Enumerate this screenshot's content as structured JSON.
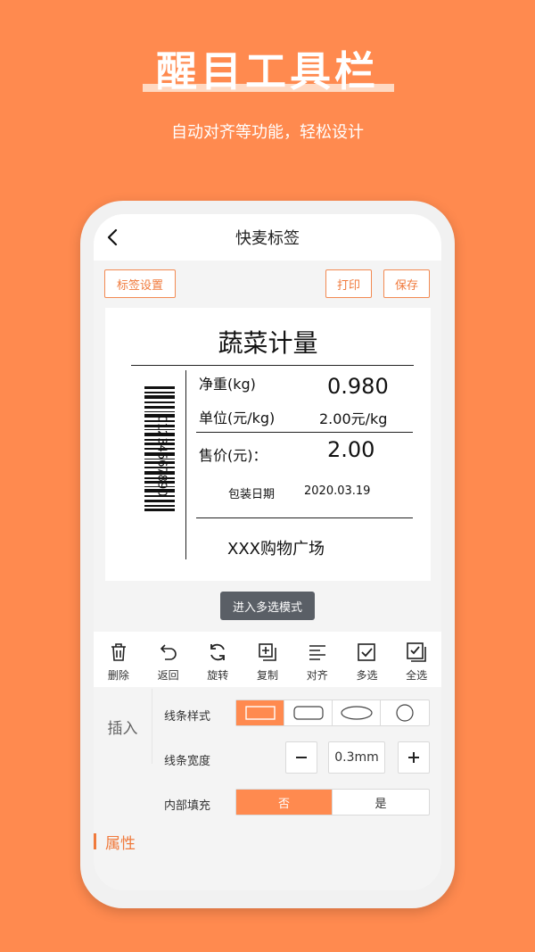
{
  "hero": {
    "title": "醒目工具栏",
    "subtitle": "自动对齐等功能，轻松设计"
  },
  "nav": {
    "title": "快麦标签"
  },
  "top_buttons": {
    "label_settings": "标签设置",
    "print": "打印",
    "save": "保存"
  },
  "label": {
    "title": "蔬菜计量",
    "barcode_number": "01234567890",
    "net_weight_label": "净重(kg)",
    "net_weight_value": "0.980",
    "unit_price_label": "单位(元/kg)",
    "unit_price_value": "2.00元/kg",
    "price_label": "售价(元)：",
    "price_value": "2.00",
    "pack_date_label": "包装日期",
    "pack_date_value": "2020.03.19",
    "store": "XXX购物广场"
  },
  "multiselect_button": "进入多选模式",
  "toolbar": {
    "items": [
      {
        "label": "删除",
        "icon": "trash-icon"
      },
      {
        "label": "返回",
        "icon": "undo-icon"
      },
      {
        "label": "旋转",
        "icon": "rotate-icon"
      },
      {
        "label": "复制",
        "icon": "copy-icon"
      },
      {
        "label": "对齐",
        "icon": "align-icon"
      },
      {
        "label": "多选",
        "icon": "checkbox-icon"
      },
      {
        "label": "全选",
        "icon": "select-all-icon"
      }
    ]
  },
  "side": {
    "insert": "插入",
    "attributes": "属性"
  },
  "props": {
    "line_style_label": "线条样式",
    "line_style_options": [
      "rectangle",
      "rounded-rectangle",
      "ellipse",
      "circle"
    ],
    "line_style_selected": 0,
    "line_width_label": "线条宽度",
    "line_width_value": "0.3mm",
    "fill_label": "内部填充",
    "fill_options": [
      "否",
      "是"
    ],
    "fill_selected": 0
  },
  "colors": {
    "background": "#FF8A4F",
    "accent": "#F07A3C",
    "dark_button": "#5A5F66"
  }
}
